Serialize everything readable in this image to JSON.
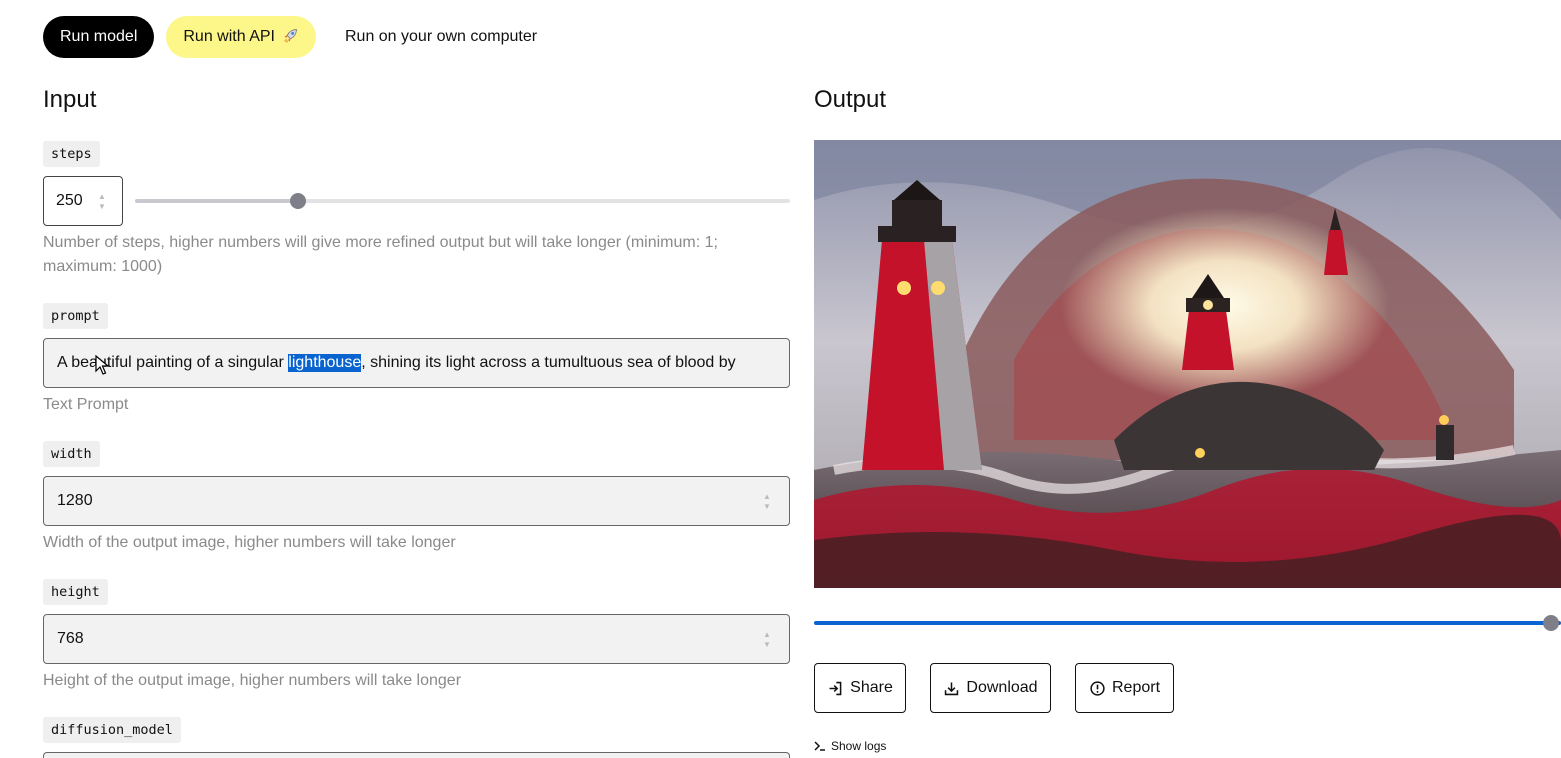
{
  "tabs": {
    "run_model": "Run model",
    "run_api": "Run with API",
    "run_api_icon": "rocket-icon",
    "run_local": "Run on your own computer"
  },
  "input": {
    "title": "Input",
    "steps": {
      "label": "steps",
      "value": "250",
      "slider_value": 250,
      "slider_min": 1,
      "slider_max": 1000,
      "description_line1": "Number of steps, higher numbers will give more refined output but will take longer (minimum: 1;",
      "description_line2": "maximum: 1000)"
    },
    "prompt": {
      "label": "prompt",
      "text_before": "A beautiful painting of a singular ",
      "text_selected": "lighthouse",
      "text_after": ", shining its light across a tumultuous sea of blood by",
      "description": "Text Prompt"
    },
    "width": {
      "label": "width",
      "value": "1280",
      "description": "Width of the output image, higher numbers will take longer"
    },
    "height": {
      "label": "height",
      "value": "768",
      "description": "Height of the output image, higher numbers will take longer"
    },
    "diffusion_model": {
      "label": "diffusion_model"
    }
  },
  "output": {
    "title": "Output",
    "progress_fraction": 1.0,
    "buttons": {
      "share": "Share",
      "download": "Download",
      "report": "Report"
    },
    "show_logs": "Show logs"
  },
  "colors": {
    "accent_blue": "#0a64d0",
    "api_yellow": "#fcf788",
    "run_black": "#000000"
  }
}
